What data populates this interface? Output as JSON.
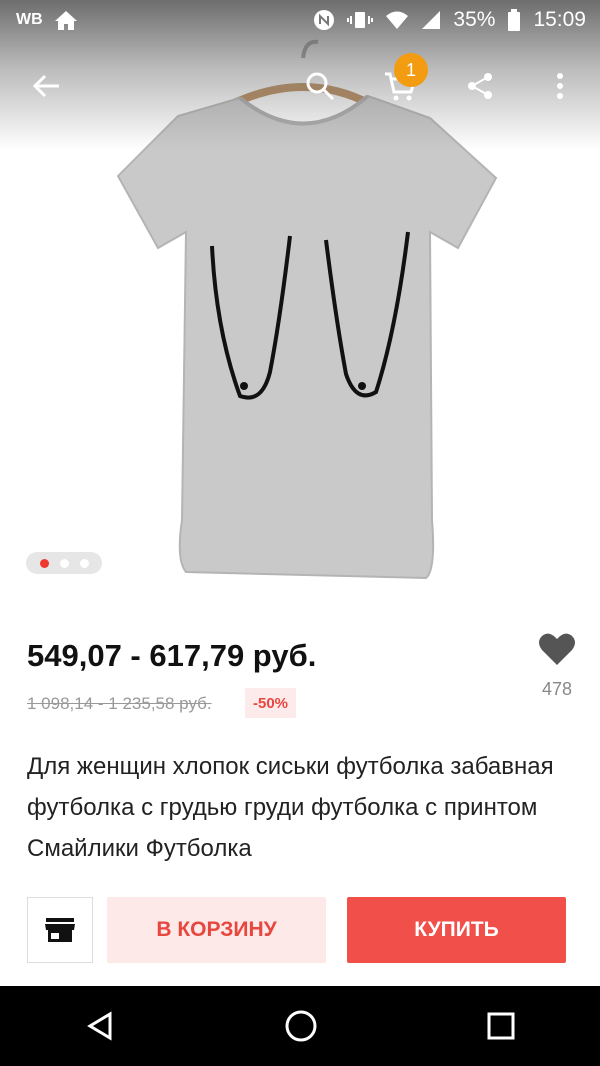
{
  "status_bar": {
    "carrier": "WB",
    "battery_percent": "35%",
    "time": "15:09",
    "icons": [
      "home-icon",
      "nfc-icon",
      "vibrate-icon",
      "wifi-icon",
      "signal-icon",
      "battery-icon"
    ]
  },
  "toolbar": {
    "icons": [
      "back-arrow-icon",
      "search-icon",
      "cart-icon",
      "share-icon",
      "more-vert-icon"
    ],
    "cart_badge": "1"
  },
  "gallery": {
    "total": 3,
    "active_index": 0
  },
  "product": {
    "price": "549,07 - 617,79 руб.",
    "old_price": "1 098,14 - 1 235,58 руб.",
    "discount": "-50%",
    "likes": "478",
    "title": "Для женщин хлопок сиськи футболка забавная футболка с грудью груди футболка с принтом Смайлики Футболка"
  },
  "actions": {
    "add_to_cart": "В КОРЗИНУ",
    "buy": "КУПИТЬ",
    "store_icon": "store-icon"
  },
  "nav_bar": {
    "icons": [
      "back-triangle-icon",
      "home-circle-icon",
      "recents-square-icon"
    ]
  },
  "colors": {
    "accent": "#f14f4a",
    "badge": "#f39c12",
    "dot_active": "#f0382f"
  }
}
